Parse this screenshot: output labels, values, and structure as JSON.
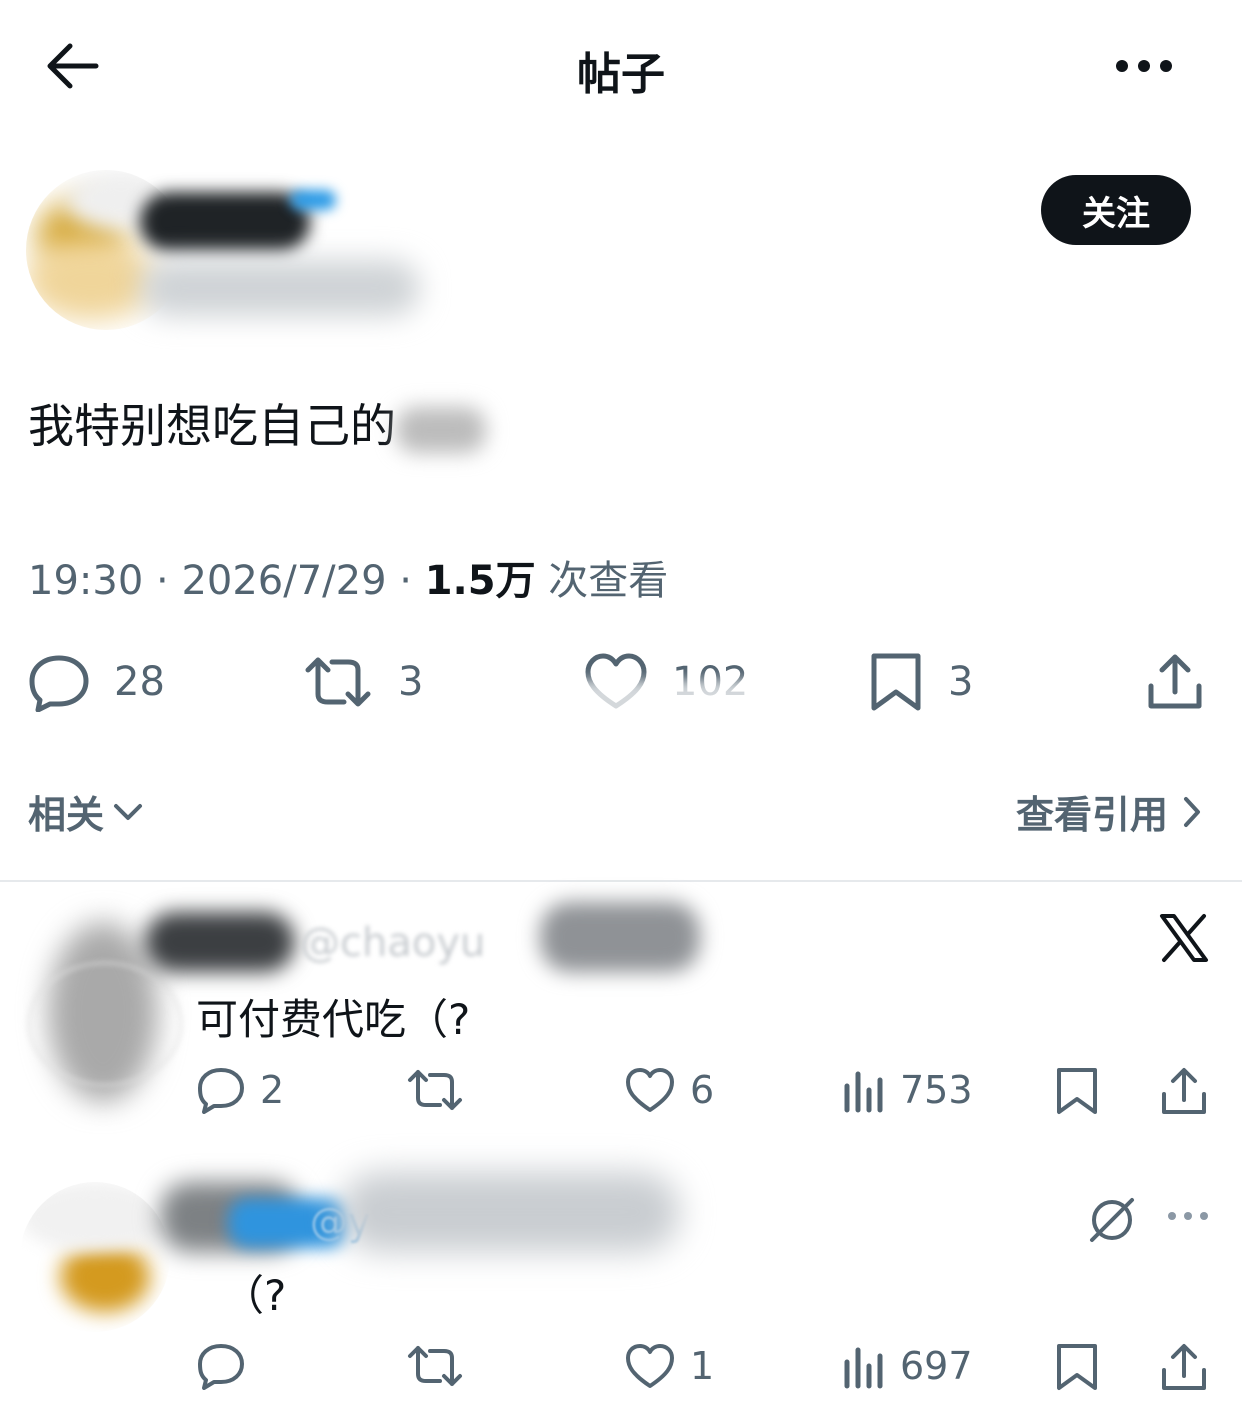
{
  "header": {
    "title": "帖子"
  },
  "post": {
    "follow_label": "关注",
    "text": "我特别想吃自己的",
    "meta": {
      "time": "19:30",
      "date": "2026/7/29",
      "separator": "·",
      "views": "1.5万",
      "views_suffix": "次查看"
    },
    "actions": {
      "replies": "28",
      "reposts": "3",
      "likes": "102",
      "bookmarks": "3"
    }
  },
  "related": {
    "label": "相关",
    "quotes_label": "查看引用"
  },
  "replies": [
    {
      "handle_fragment": "@chaoyu",
      "text": "可付费代吃（?",
      "replies": "2",
      "likes": "6",
      "views": "753"
    },
    {
      "handle_fragment": "@y",
      "text": "（?",
      "likes": "1",
      "views": "697"
    }
  ],
  "colors": {
    "text": "#0f1419",
    "secondary": "#536471",
    "accent": "#1d9bf0",
    "button": "#0f1419"
  }
}
